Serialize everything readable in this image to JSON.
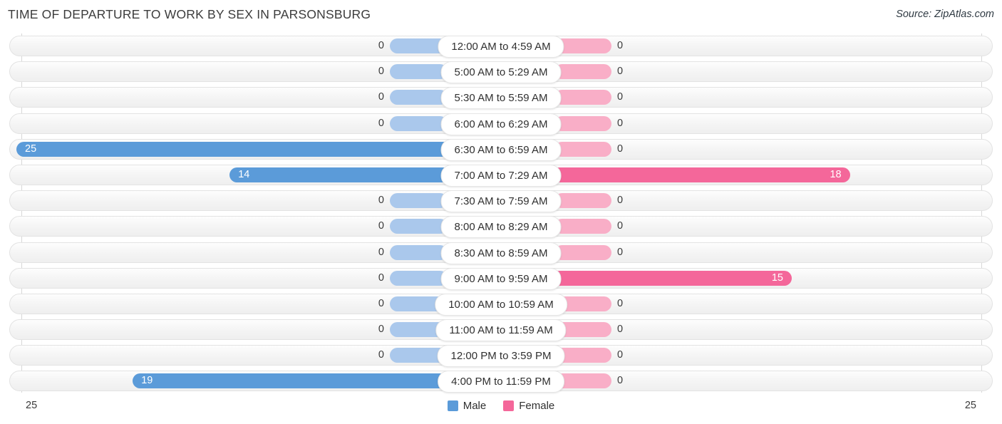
{
  "header": {
    "title": "TIME OF DEPARTURE TO WORK BY SEX IN PARSONSBURG",
    "source": "Source: ZipAtlas.com"
  },
  "legend": {
    "male_label": "Male",
    "female_label": "Female",
    "male_color": "#5b9bd9",
    "female_color": "#f4679a",
    "male_zero_color": "#aac8ec",
    "female_zero_color": "#f9aec7"
  },
  "axis": {
    "min_label": "25",
    "max_label": "25",
    "scale_max": 25
  },
  "chart_data": {
    "type": "bar",
    "title": "TIME OF DEPARTURE TO WORK BY SEX IN PARSONSBURG",
    "subtitle": "",
    "xlabel": "",
    "ylabel": "",
    "orientation": "horizontal",
    "layout": "diverging-bidirectional",
    "legend_position": "bottom-center",
    "grid": true,
    "xlim": [
      25,
      25
    ],
    "categories": [
      "12:00 AM to 4:59 AM",
      "5:00 AM to 5:29 AM",
      "5:30 AM to 5:59 AM",
      "6:00 AM to 6:29 AM",
      "6:30 AM to 6:59 AM",
      "7:00 AM to 7:29 AM",
      "7:30 AM to 7:59 AM",
      "8:00 AM to 8:29 AM",
      "8:30 AM to 8:59 AM",
      "9:00 AM to 9:59 AM",
      "10:00 AM to 10:59 AM",
      "11:00 AM to 11:59 AM",
      "12:00 PM to 3:59 PM",
      "4:00 PM to 11:59 PM"
    ],
    "series": [
      {
        "name": "Male",
        "side": "left",
        "color": "#5b9bd9",
        "values": [
          0,
          0,
          0,
          0,
          25,
          14,
          0,
          0,
          0,
          0,
          0,
          0,
          0,
          19
        ]
      },
      {
        "name": "Female",
        "side": "right",
        "color": "#f4679a",
        "values": [
          0,
          0,
          0,
          0,
          0,
          18,
          0,
          0,
          0,
          15,
          0,
          0,
          0,
          0
        ]
      }
    ]
  },
  "rows": [
    {
      "category": "12:00 AM to 4:59 AM",
      "male": 0,
      "male_text": "0",
      "female": 0,
      "female_text": "0"
    },
    {
      "category": "5:00 AM to 5:29 AM",
      "male": 0,
      "male_text": "0",
      "female": 0,
      "female_text": "0"
    },
    {
      "category": "5:30 AM to 5:59 AM",
      "male": 0,
      "male_text": "0",
      "female": 0,
      "female_text": "0"
    },
    {
      "category": "6:00 AM to 6:29 AM",
      "male": 0,
      "male_text": "0",
      "female": 0,
      "female_text": "0"
    },
    {
      "category": "6:30 AM to 6:59 AM",
      "male": 25,
      "male_text": "25",
      "female": 0,
      "female_text": "0"
    },
    {
      "category": "7:00 AM to 7:29 AM",
      "male": 14,
      "male_text": "14",
      "female": 18,
      "female_text": "18"
    },
    {
      "category": "7:30 AM to 7:59 AM",
      "male": 0,
      "male_text": "0",
      "female": 0,
      "female_text": "0"
    },
    {
      "category": "8:00 AM to 8:29 AM",
      "male": 0,
      "male_text": "0",
      "female": 0,
      "female_text": "0"
    },
    {
      "category": "8:30 AM to 8:59 AM",
      "male": 0,
      "male_text": "0",
      "female": 0,
      "female_text": "0"
    },
    {
      "category": "9:00 AM to 9:59 AM",
      "male": 0,
      "male_text": "0",
      "female": 15,
      "female_text": "15"
    },
    {
      "category": "10:00 AM to 10:59 AM",
      "male": 0,
      "male_text": "0",
      "female": 0,
      "female_text": "0"
    },
    {
      "category": "11:00 AM to 11:59 AM",
      "male": 0,
      "male_text": "0",
      "female": 0,
      "female_text": "0"
    },
    {
      "category": "12:00 PM to 3:59 PM",
      "male": 0,
      "male_text": "0",
      "female": 0,
      "female_text": "0"
    },
    {
      "category": "4:00 PM to 11:59 PM",
      "male": 19,
      "male_text": "19",
      "female": 0,
      "female_text": "0"
    }
  ]
}
